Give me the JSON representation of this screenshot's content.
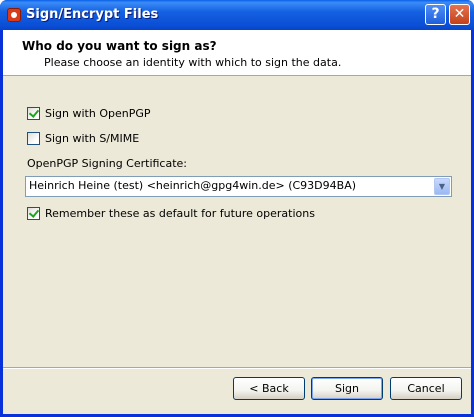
{
  "window": {
    "title": "Sign/Encrypt Files",
    "help_glyph": "?",
    "close_glyph": "✕"
  },
  "header": {
    "title": "Who do you want to sign as?",
    "subtitle": "Please choose an identity with which to sign the data."
  },
  "options": {
    "openpgp": {
      "label": "Sign with OpenPGP",
      "checked": true
    },
    "smime": {
      "label": "Sign with S/MIME",
      "checked": false
    },
    "remember": {
      "label": "Remember these as default for future operations",
      "checked": true
    }
  },
  "certificate": {
    "label": "OpenPGP Signing Certificate:",
    "selected": "Heinrich Heine (test) <heinrich@gpg4win.de> (C93D94BA)"
  },
  "buttons": {
    "back": "< Back",
    "sign": "Sign",
    "cancel": "Cancel"
  },
  "colors": {
    "titlebar": "#0a4fd6",
    "dialog_bg": "#ece9d8",
    "check_mark": "#21a121"
  },
  "icons": {
    "app": "gpg4win-app-icon",
    "dropdown": "chevron-down-icon"
  }
}
